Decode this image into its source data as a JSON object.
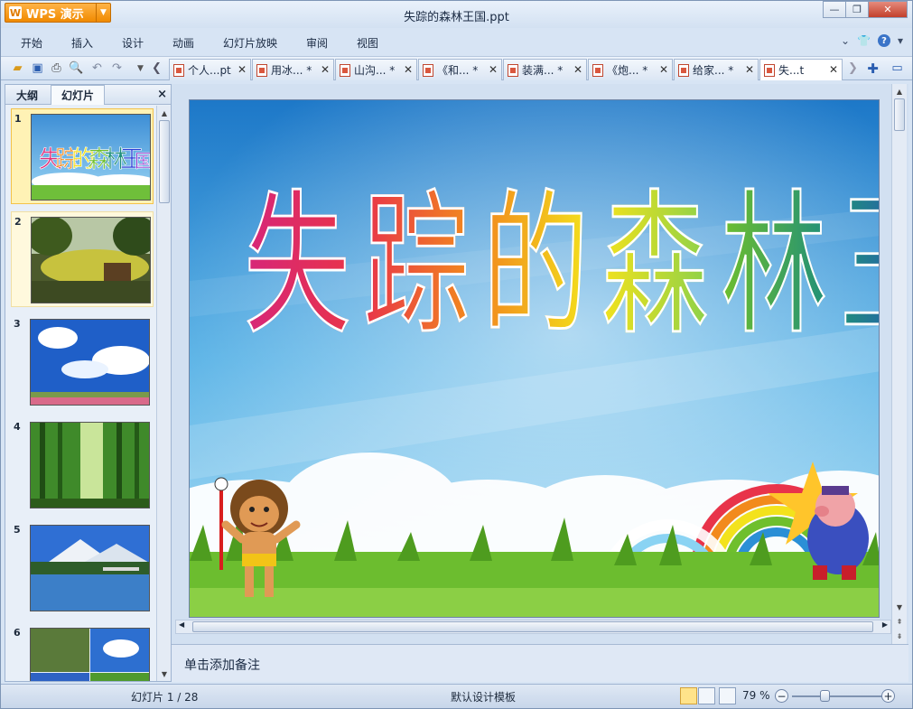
{
  "app": {
    "name": "WPS 演示",
    "document_title": "失踪的森林王国.ppt"
  },
  "menu": [
    "开始",
    "插入",
    "设计",
    "动画",
    "幻灯片放映",
    "审阅",
    "视图"
  ],
  "tabs": [
    {
      "label": "个人...pt"
    },
    {
      "label": "用冰... *"
    },
    {
      "label": "山沟... *"
    },
    {
      "label": "《和... *"
    },
    {
      "label": "装满... *"
    },
    {
      "label": "《炮... *"
    },
    {
      "label": "给家... *"
    },
    {
      "label": "失...t",
      "active": true
    }
  ],
  "left_pane": {
    "tabs": [
      "大纲",
      "幻灯片"
    ],
    "active_tab": "幻灯片",
    "close": "×"
  },
  "slides": [
    {
      "number": "1",
      "selected": true
    },
    {
      "number": "2"
    },
    {
      "number": "3"
    },
    {
      "number": "4"
    },
    {
      "number": "5"
    },
    {
      "number": "6"
    }
  ],
  "slide": {
    "title": "失踪的森林王国",
    "title_colors": [
      "#d6267a",
      "#e8334a",
      "#f28a1d",
      "#f3e21c",
      "#6fbf2d",
      "#1f8f7a",
      "#2b3fd6"
    ],
    "notes_placeholder": "单击添加备注"
  },
  "status": {
    "slide_indicator": "幻灯片 1 / 28",
    "template": "默认设计模板",
    "zoom": "79 %"
  },
  "colors": {
    "accent": "#f08a00"
  }
}
